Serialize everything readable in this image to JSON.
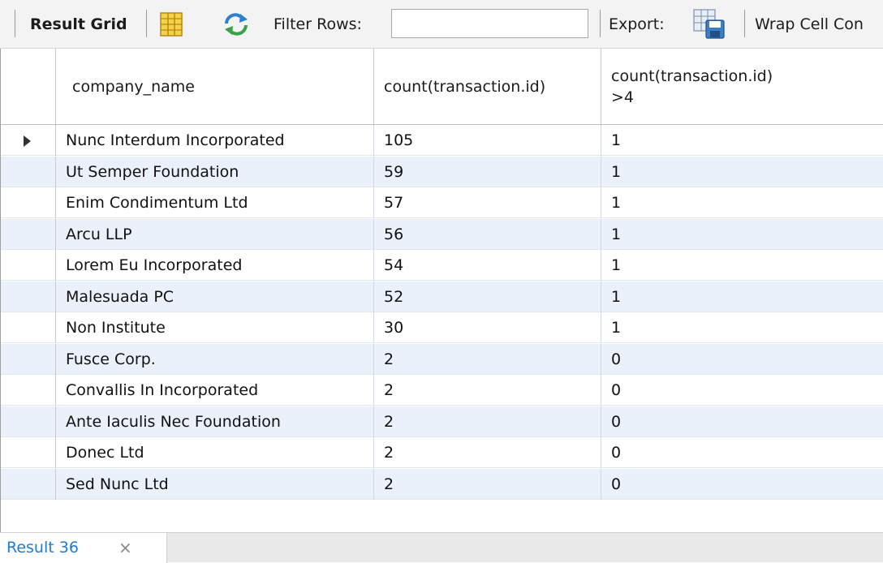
{
  "toolbar": {
    "result_grid_label": "Result Grid",
    "filter_rows_label": "Filter Rows:",
    "filter_value": "",
    "export_label": "Export:",
    "wrap_label": "Wrap Cell Con"
  },
  "grid": {
    "columns": [
      "company_name",
      "count(transaction.id)",
      "count(transaction.id)\n>4"
    ],
    "rows": [
      [
        "Nunc Interdum Incorporated",
        "105",
        "1"
      ],
      [
        "Ut Semper Foundation",
        "59",
        "1"
      ],
      [
        "Enim Condimentum Ltd",
        "57",
        "1"
      ],
      [
        "Arcu LLP",
        "56",
        "1"
      ],
      [
        "Lorem Eu Incorporated",
        "54",
        "1"
      ],
      [
        "Malesuada PC",
        "52",
        "1"
      ],
      [
        "Non Institute",
        "30",
        "1"
      ],
      [
        "Fusce Corp.",
        "2",
        "0"
      ],
      [
        "Convallis In Incorporated",
        "2",
        "0"
      ],
      [
        "Ante Iaculis Nec Foundation",
        "2",
        "0"
      ],
      [
        "Donec Ltd",
        "2",
        "0"
      ],
      [
        "Sed Nunc Ltd",
        "2",
        "0"
      ]
    ],
    "selected_row": 0
  },
  "bottom_tab": {
    "label": "Result 36",
    "close": "×"
  },
  "colors": {
    "alt_row": "#ebf1fb",
    "tab_text": "#1f7ad6"
  },
  "icons": [
    "grid-layout-icon",
    "refresh-icon",
    "export-save-icon",
    "row-selector-arrow-icon",
    "close-icon"
  ]
}
